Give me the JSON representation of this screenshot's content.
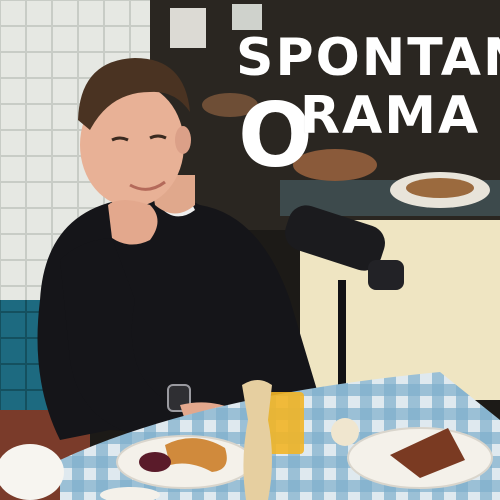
{
  "cover": {
    "title_line1": "SPONTAN",
    "title_o": "O",
    "title_line2": "RAMA"
  },
  "colors": {
    "title": "#ffffff",
    "tile_wall": "#e9ebe6",
    "tile_teal": "#1f6f86",
    "shirt": "#15151a",
    "tablecloth_blue": "#6fa6c6",
    "cream_wall": "#efe7c9"
  }
}
